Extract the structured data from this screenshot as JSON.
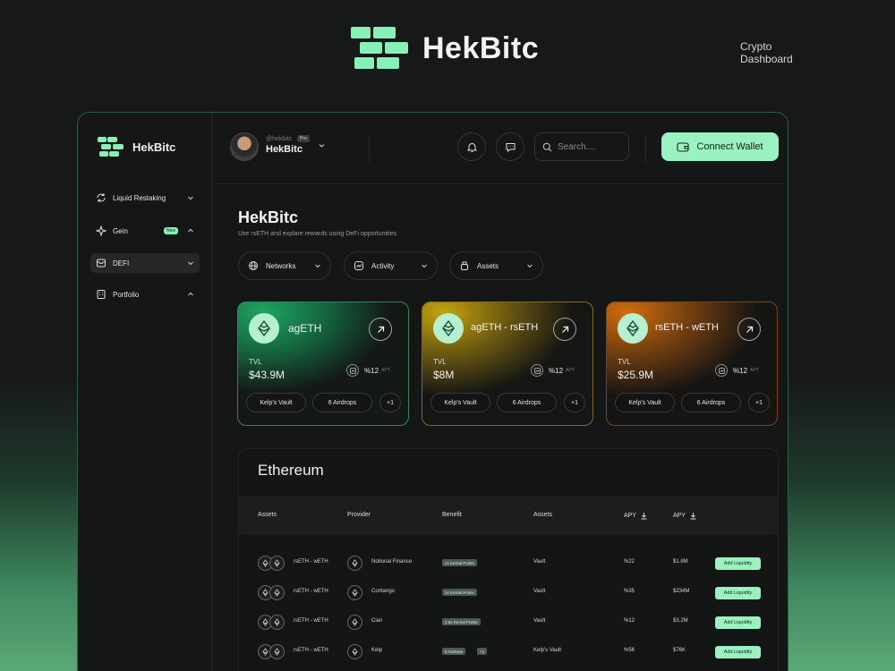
{
  "brand": {
    "name": "HekBitc",
    "tagline_line1": "Crypto",
    "tagline_line2": "Dashboard"
  },
  "colors": {
    "accent": "#9af2c0",
    "frame_border": "#2f5e46",
    "card_green": "#1f9a5a",
    "card_yellow": "#b59a10",
    "card_orange": "#c8620c"
  },
  "sidebar": {
    "logo": "HekBitc",
    "items": [
      {
        "label": "Liquid Restaking",
        "icon": "restaking-icon"
      },
      {
        "label": "Gein",
        "icon": "sparkle-icon",
        "badge": "New"
      },
      {
        "label": "DEFI",
        "icon": "inbox-icon"
      },
      {
        "label": "Portfolio",
        "icon": "portfolio-icon"
      }
    ]
  },
  "topbar": {
    "user_handle": "@hekbitc",
    "user_badge": "Pro",
    "user_name": "HekBitc",
    "search_placeholder": "Search....",
    "connect_label": "Connect Wallet"
  },
  "main": {
    "title": "HekBitc",
    "subtitle": "Use  rsETH and explare rewards using DeFi opportunities",
    "filters": [
      "Networks",
      "Activity",
      "Assets"
    ]
  },
  "cards": [
    {
      "name": "agETH",
      "tvl_label": "TVL",
      "tvl": "$43.9M",
      "apy": "%12",
      "apy_label": "APY",
      "vault": "Kelp's Vault",
      "airdrops": "6 Airdrops",
      "more": "+1"
    },
    {
      "name": "agETH - rsETH",
      "tvl_label": "TVL",
      "tvl": "$8M",
      "apy": "%12",
      "apy_label": "APY",
      "vault": "Kelp's Vault",
      "airdrops": "6 Airdrops",
      "more": "+1"
    },
    {
      "name": "rsETH - wETH",
      "tvl_label": "TVL",
      "tvl": "$25.9M",
      "apy": "%12",
      "apy_label": "APY",
      "vault": "Kelp's Vault",
      "airdrops": "6 Airdrops",
      "more": "+1"
    }
  ],
  "table": {
    "title": "Ethereum",
    "headers": [
      "Assets",
      "Provider",
      "Benefit",
      "Assets",
      "APY",
      "APY"
    ],
    "rows": [
      {
        "asset": "rsETH - wETH",
        "provider": "Notional Finance",
        "benefit": "2x Kernal Points",
        "benefit_extra": "",
        "assets": "Vault",
        "apy": "%22",
        "tvl": "$1.8M",
        "action": "Add Liquidity"
      },
      {
        "asset": "rsETH - wETH",
        "provider": "Contango",
        "benefit": "2x Kernal Points",
        "benefit_extra": "",
        "assets": "Vault",
        "apy": "%35",
        "tvl": "$234M",
        "action": "Add Liquidity"
      },
      {
        "asset": "rsETH - wETH",
        "provider": "Cian",
        "benefit": "2.5x Kernal Points",
        "benefit_extra": "",
        "assets": "Vault",
        "apy": "%12",
        "tvl": "$3.2M",
        "action": "Add Liquidity"
      },
      {
        "asset": "rsETH - wETH",
        "provider": "Kelp",
        "benefit": "6 Airdrops",
        "benefit_extra": "+1",
        "assets": "Kelp's Vault",
        "apy": "%56",
        "tvl": "$76K",
        "action": "Add Liquidity"
      }
    ]
  }
}
